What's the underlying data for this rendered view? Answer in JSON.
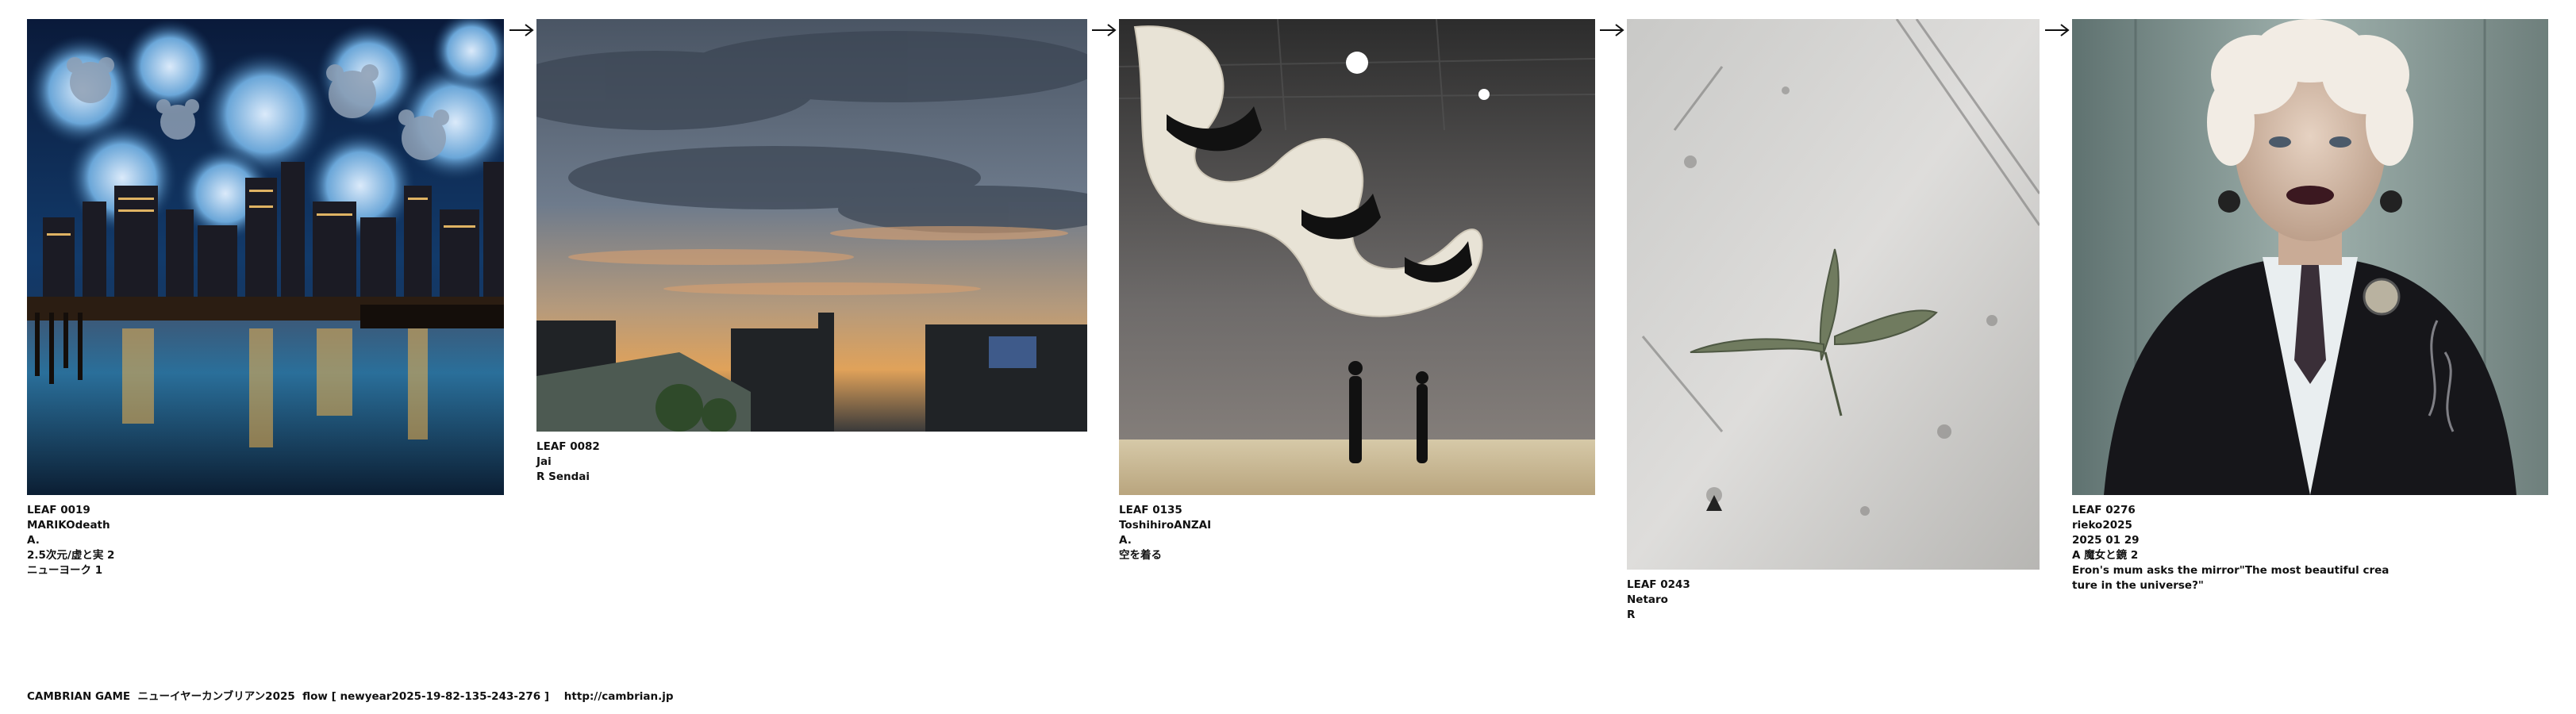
{
  "leaves": [
    {
      "id": "LEAF 0019",
      "author": "MARIKOdeath",
      "lines": [
        "A.",
        "2.5次元/虚と実 2",
        "ニューヨーク 1"
      ],
      "image": "teddy-bear-clouds-over-city-skyline"
    },
    {
      "id": "LEAF 0082",
      "author": "Jai",
      "lines": [
        "R Sendai"
      ],
      "image": "sunset-sky-over-buildings"
    },
    {
      "id": "LEAF 0135",
      "author": "ToshihiroANZAI",
      "lines": [
        "A.",
        "空を着る"
      ],
      "image": "ribbon-sculpture-runway"
    },
    {
      "id": "LEAF 0243",
      "author": "Netaro",
      "lines": [
        "R"
      ],
      "image": "seedling-on-concrete"
    },
    {
      "id": "LEAF 0276",
      "author": "rieko2025",
      "lines": [
        "2025 01 29",
        "A 魔女と鏡 2",
        "Eron's mum asks the mirror\"The most beautiful crea",
        "ture in the universe?\""
      ],
      "image": "portrait-old-woman"
    }
  ],
  "footer": "CAMBRIAN GAME  ニューイヤーカンブリアン2025  flow [ newyear2025-19-82-135-243-276 ]    http://cambrian.jp",
  "arrow_icon": "right-arrow-icon"
}
